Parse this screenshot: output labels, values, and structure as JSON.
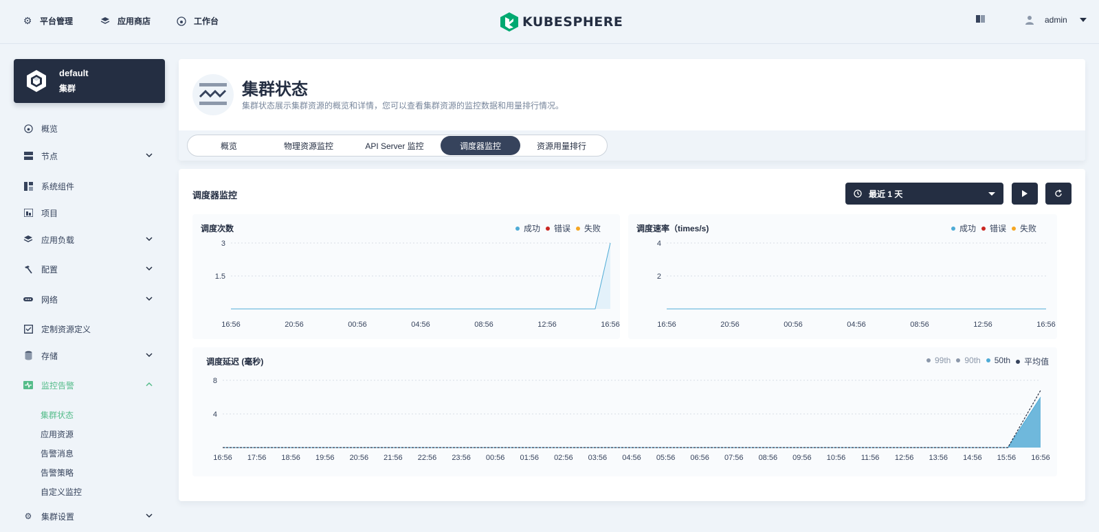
{
  "topnav": {
    "items": [
      {
        "label": "平台管理",
        "icon": "gear-icon"
      },
      {
        "label": "应用商店",
        "icon": "layers-icon"
      },
      {
        "label": "工作台",
        "icon": "dashboard-icon"
      }
    ],
    "logo_text": "KUBESPHERE",
    "user": "admin"
  },
  "cluster": {
    "name": "default",
    "sub": "集群"
  },
  "sidebar": {
    "items": [
      {
        "label": "概览",
        "icon": "dashboard-icon",
        "expandable": false
      },
      {
        "label": "节点",
        "icon": "server-icon",
        "expandable": true
      },
      {
        "label": "系统组件",
        "icon": "components-icon",
        "expandable": false
      },
      {
        "label": "项目",
        "icon": "project-icon",
        "expandable": false
      },
      {
        "label": "应用负载",
        "icon": "layers-icon",
        "expandable": true
      },
      {
        "label": "配置",
        "icon": "hammer-icon",
        "expandable": true
      },
      {
        "label": "网络",
        "icon": "network-icon",
        "expandable": true
      },
      {
        "label": "定制资源定义",
        "icon": "crd-icon",
        "expandable": false
      },
      {
        "label": "存储",
        "icon": "storage-icon",
        "expandable": true
      },
      {
        "label": "监控告警",
        "icon": "monitor-icon",
        "expandable": true,
        "active": true
      },
      {
        "label": "集群设置",
        "icon": "gear-icon",
        "expandable": true
      }
    ],
    "subitems": [
      {
        "label": "集群状态",
        "active": true
      },
      {
        "label": "应用资源"
      },
      {
        "label": "告警消息"
      },
      {
        "label": "告警策略"
      },
      {
        "label": "自定义监控"
      }
    ]
  },
  "header": {
    "title": "集群状态",
    "description": "集群状态展示集群资源的概览和详情，您可以查看集群资源的监控数据和用量排行情况。",
    "tabs": [
      "概览",
      "物理资源监控",
      "API Server 监控",
      "调度器监控",
      "资源用量排行"
    ],
    "active_tab": 3
  },
  "panel": {
    "title": "调度器监控",
    "time_range": "最近 1 天"
  },
  "colors": {
    "success": "#4eabd6",
    "error": "#ca2621",
    "fail": "#f5a623",
    "p99": "#8c98aa",
    "p90": "#8c98aa",
    "p50": "#4eabd6",
    "avg": "#36435c"
  },
  "chart_data": [
    {
      "type": "area",
      "title": "调度次数",
      "legend": [
        "成功",
        "错误",
        "失败"
      ],
      "x": [
        "16:56",
        "20:56",
        "00:56",
        "04:56",
        "08:56",
        "12:56",
        "16:56"
      ],
      "yticks": [
        "3",
        "1.5"
      ],
      "ylim": [
        0,
        3
      ],
      "series": [
        {
          "name": "成功",
          "points": [
            [
              0,
              0
            ],
            [
              0.96,
              0
            ],
            [
              1,
              3
            ]
          ]
        }
      ]
    },
    {
      "type": "line",
      "title": "调度速率（times/s)",
      "legend": [
        "成功",
        "错误",
        "失败"
      ],
      "x": [
        "16:56",
        "20:56",
        "00:56",
        "04:56",
        "08:56",
        "12:56",
        "16:56"
      ],
      "yticks": [
        "4",
        "2"
      ],
      "ylim": [
        0,
        4
      ],
      "series": [
        {
          "name": "成功",
          "points": [
            [
              0,
              0
            ],
            [
              1,
              0
            ]
          ]
        }
      ]
    },
    {
      "type": "area",
      "title": "调度延迟 (毫秒)",
      "legend": [
        "99th",
        "90th",
        "50th",
        "平均值"
      ],
      "x": [
        "16:56",
        "17:56",
        "18:56",
        "19:56",
        "20:56",
        "21:56",
        "22:56",
        "23:56",
        "00:56",
        "01:56",
        "02:56",
        "03:56",
        "04:56",
        "05:56",
        "06:56",
        "07:56",
        "08:56",
        "09:56",
        "10:56",
        "11:56",
        "12:56",
        "13:56",
        "14:56",
        "15:56",
        "16:56"
      ],
      "yticks": [
        "8",
        "4"
      ],
      "ylim": [
        0,
        8
      ],
      "series": [
        {
          "name": "50th",
          "points": [
            [
              0,
              0
            ],
            [
              0.96,
              0
            ],
            [
              1,
              6
            ]
          ]
        },
        {
          "name": "平均值",
          "points": [
            [
              0,
              0
            ],
            [
              0.96,
              0
            ],
            [
              1,
              6.8
            ]
          ]
        }
      ]
    }
  ]
}
